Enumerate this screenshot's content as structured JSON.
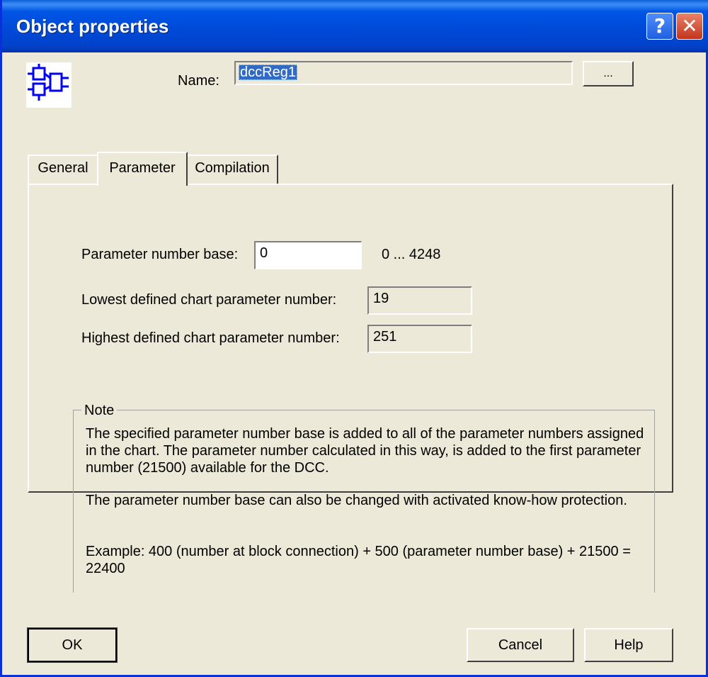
{
  "window": {
    "title": "Object properties",
    "help_glyph": "?",
    "close_glyph": "✕"
  },
  "object": {
    "icon": "function-block-icon",
    "name_label": "Name:",
    "name_value": "dccReg1",
    "browse_label": "..."
  },
  "tabs": [
    {
      "label": "General"
    },
    {
      "label": "Parameter",
      "active": true
    },
    {
      "label": "Compilation"
    }
  ],
  "parameter": {
    "base_label": "Parameter number base:",
    "base_value": "0",
    "range_text": "0 ... 4248",
    "lowest_label": "Lowest defined chart parameter number:",
    "lowest_value": "19",
    "highest_label": "Highest defined chart parameter number:",
    "highest_value": "251"
  },
  "note": {
    "title": "Note",
    "para1": "The specified parameter number base is added to all of the parameter numbers assigned in the chart. The parameter number calculated in this way, is added to the first parameter number (21500) available for the DCC.",
    "para2": "The parameter number base can also be changed with activated know-how protection.",
    "para3": "Example: 400 (number at block connection) + 500 (parameter number base) + 21500 = 22400"
  },
  "buttons": {
    "ok": "OK",
    "cancel": "Cancel",
    "help": "Help"
  },
  "colors": {
    "titlebar": "#0055e5",
    "dialog_bg": "#ece9d8",
    "selection": "#316ac5",
    "icon_blue": "#0000ff"
  }
}
